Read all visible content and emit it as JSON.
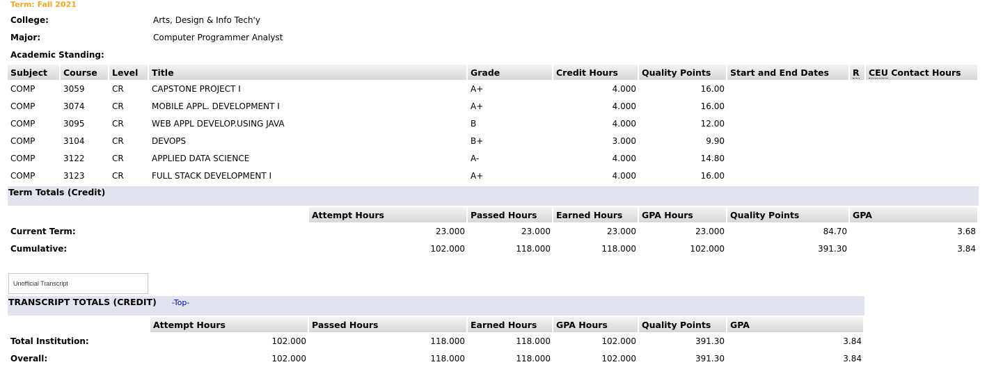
{
  "term_title": "Term: Fall 2021",
  "info": [
    {
      "label": "College:",
      "value": "Arts, Design & Info Tech'y"
    },
    {
      "label": "Major:",
      "value": "Computer Programmer Analyst"
    },
    {
      "label": "Academic Standing:",
      "value": ""
    }
  ],
  "course_table": {
    "headers": {
      "subject": "Subject",
      "course": "Course",
      "level": "Level",
      "title": "Title",
      "grade": "Grade",
      "credit_hours": "Credit Hours",
      "quality_points": "Quality Points",
      "dates": "Start and End Dates",
      "r": "R",
      "ceu": "CEU",
      "contact_hours": "Contact Hours"
    },
    "rows": [
      {
        "subject": "COMP",
        "course": "3059",
        "level": "CR",
        "title": "CAPSTONE PROJECT I",
        "grade": "A+",
        "credit_hours": "4.000",
        "quality_points": "16.00"
      },
      {
        "subject": "COMP",
        "course": "3074",
        "level": "CR",
        "title": "MOBILE APPL. DEVELOPMENT I",
        "grade": "A+",
        "credit_hours": "4.000",
        "quality_points": "16.00"
      },
      {
        "subject": "COMP",
        "course": "3095",
        "level": "CR",
        "title": "WEB APPL DEVELOP.USING JAVA",
        "grade": "B",
        "credit_hours": "4.000",
        "quality_points": "12.00"
      },
      {
        "subject": "COMP",
        "course": "3104",
        "level": "CR",
        "title": "DEVOPS",
        "grade": "B+",
        "credit_hours": "3.000",
        "quality_points": "9.90"
      },
      {
        "subject": "COMP",
        "course": "3122",
        "level": "CR",
        "title": "APPLIED DATA SCIENCE",
        "grade": "A-",
        "credit_hours": "4.000",
        "quality_points": "14.80"
      },
      {
        "subject": "COMP",
        "course": "3123",
        "level": "CR",
        "title": "FULL STACK DEVELOPMENT I",
        "grade": "A+",
        "credit_hours": "4.000",
        "quality_points": "16.00"
      }
    ]
  },
  "term_totals": {
    "band_title": "Term Totals (Credit)",
    "headers": [
      "Attempt Hours",
      "Passed Hours",
      "Earned Hours",
      "GPA Hours",
      "Quality Points",
      "GPA"
    ],
    "rows": [
      {
        "label": "Current Term:",
        "values": [
          "23.000",
          "23.000",
          "23.000",
          "23.000",
          "84.70",
          "3.68"
        ]
      },
      {
        "label": "Cumulative:",
        "values": [
          "102.000",
          "118.000",
          "118.000",
          "102.000",
          "391.30",
          "3.84"
        ]
      }
    ]
  },
  "unofficial_button": "Unofficial Transcript",
  "transcript_totals": {
    "band_title": "TRANSCRIPT TOTALS (CREDIT)",
    "top_link": "-Top-",
    "headers": [
      "Attempt Hours",
      "Passed Hours",
      "Earned Hours",
      "GPA Hours",
      "Quality Points",
      "GPA"
    ],
    "rows": [
      {
        "label": "Total Institution:",
        "values": [
          "102.000",
          "118.000",
          "118.000",
          "102.000",
          "391.30",
          "3.84"
        ]
      },
      {
        "label": "Overall:",
        "values": [
          "102.000",
          "118.000",
          "118.000",
          "102.000",
          "391.30",
          "3.84"
        ]
      }
    ]
  }
}
